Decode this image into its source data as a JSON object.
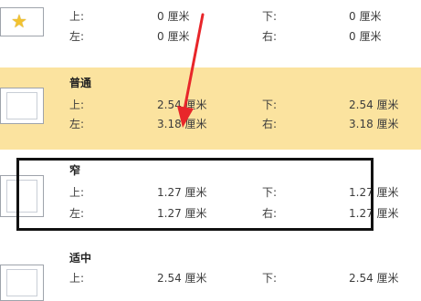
{
  "presets": [
    {
      "name": "",
      "icon": "custom-margin-star-icon",
      "top_label": "上:",
      "top_value": "0 厘米",
      "bottom_label": "下:",
      "bottom_value": "0 厘米",
      "left_label": "左:",
      "left_value": "0 厘米",
      "right_label": "右:",
      "right_value": "0 厘米"
    },
    {
      "name": "普通",
      "icon": "page-margin-icon",
      "top_label": "上:",
      "top_value": "2.54 厘米",
      "bottom_label": "下:",
      "bottom_value": "2.54 厘米",
      "left_label": "左:",
      "left_value": "3.18 厘米",
      "right_label": "右:",
      "right_value": "3.18 厘米"
    },
    {
      "name": "窄",
      "icon": "page-margin-icon",
      "top_label": "上:",
      "top_value": "1.27 厘米",
      "bottom_label": "下:",
      "bottom_value": "1.27 厘米",
      "left_label": "左:",
      "left_value": "1.27 厘米",
      "right_label": "右:",
      "right_value": "1.27 厘米"
    },
    {
      "name": "适中",
      "icon": "page-margin-icon",
      "top_label": "上:",
      "top_value": "2.54 厘米",
      "bottom_label": "下:",
      "bottom_value": "2.54 厘米"
    }
  ],
  "colors": {
    "selected_bg": "#fbe39f",
    "annotation_red": "#e8262a",
    "annotation_box": "#111111"
  }
}
